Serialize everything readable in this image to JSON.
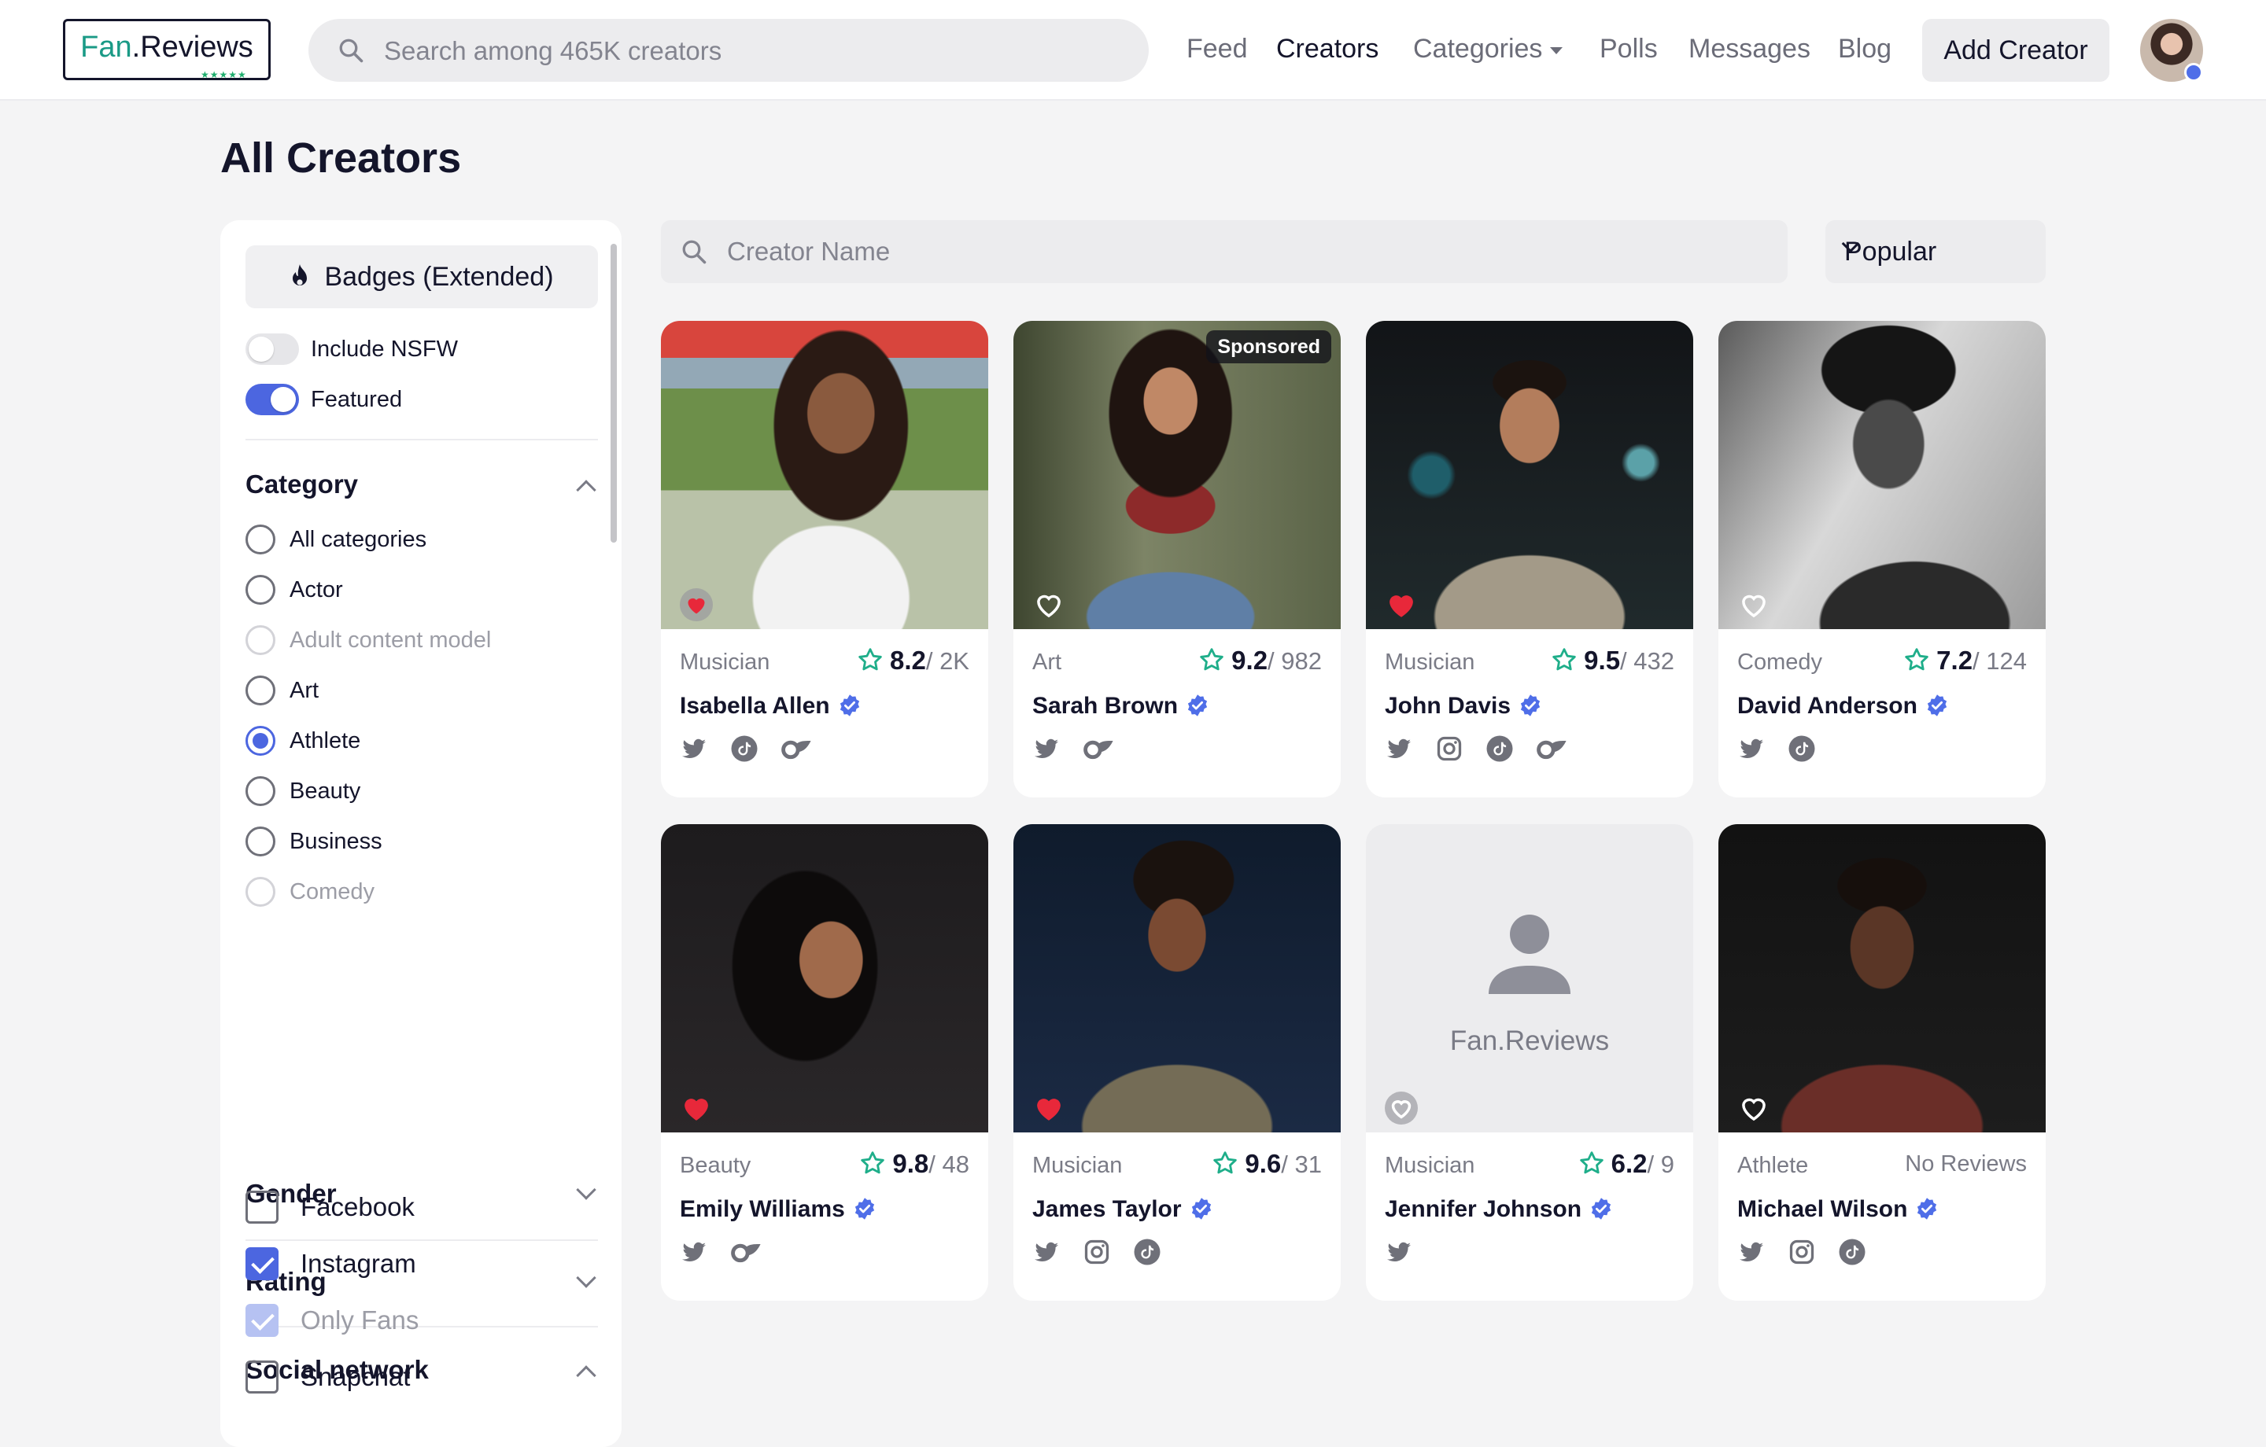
{
  "header": {
    "logo_fan": "Fan",
    "logo_rest": ".Reviews",
    "logo_stars": "★★★★★",
    "search_placeholder": "Search among 465K creators",
    "nav": [
      {
        "label": "Feed",
        "active": false
      },
      {
        "label": "Creators",
        "active": true
      },
      {
        "label": "Categories",
        "active": false
      },
      {
        "label": "Polls",
        "active": false
      },
      {
        "label": "Messages",
        "active": false
      },
      {
        "label": "Blog",
        "active": false
      }
    ],
    "add_creator": "Add Creator"
  },
  "page": {
    "title": "All Creators"
  },
  "filters": {
    "badges_button": "Badges (Extended)",
    "include_nsfw": {
      "label": "Include NSFW",
      "on": false
    },
    "featured": {
      "label": "Featured",
      "on": true
    },
    "category": {
      "title": "Category",
      "options": [
        {
          "label": "All categories",
          "state": "normal"
        },
        {
          "label": "Actor",
          "state": "normal"
        },
        {
          "label": "Adult content model",
          "state": "disabled"
        },
        {
          "label": "Art",
          "state": "normal"
        },
        {
          "label": "Athlete",
          "state": "selected"
        },
        {
          "label": "Beauty",
          "state": "normal"
        },
        {
          "label": "Business",
          "state": "normal"
        },
        {
          "label": "Comedy",
          "state": "disabled"
        }
      ]
    },
    "gender": {
      "title": "Gender"
    },
    "rating": {
      "title": "Rating"
    },
    "social": {
      "title": "Social network",
      "options": [
        {
          "label": "Facebook",
          "state": "off"
        },
        {
          "label": "Instagram",
          "state": "on"
        },
        {
          "label": "Only Fans",
          "state": "dim"
        },
        {
          "label": "Snapchat",
          "state": "off"
        }
      ]
    }
  },
  "main": {
    "search_placeholder": "Creator Name",
    "sort_value": "Popular"
  },
  "creators": [
    {
      "name": "Isabella Allen",
      "category": "Musician",
      "score": "8.2",
      "count": "/ 2K",
      "favorited": true,
      "sponsored": false,
      "socials": [
        "twitter-icon",
        "tiktok-icon",
        "onlyfans-icon"
      ]
    },
    {
      "name": "Sarah Brown",
      "category": "Art",
      "score": "9.2",
      "count": "/ 982",
      "favorited": false,
      "sponsored": true,
      "socials": [
        "twitter-icon",
        "onlyfans-icon"
      ]
    },
    {
      "name": "John Davis",
      "category": "Musician",
      "score": "9.5",
      "count": "/ 432",
      "favorited": true,
      "sponsored": false,
      "socials": [
        "twitter-icon",
        "instagram-icon",
        "tiktok-icon",
        "onlyfans-icon"
      ]
    },
    {
      "name": "David Anderson",
      "category": "Comedy",
      "score": "7.2",
      "count": "/ 124",
      "favorited": false,
      "sponsored": false,
      "socials": [
        "twitter-icon",
        "tiktok-icon"
      ]
    },
    {
      "name": "Emily Williams",
      "category": "Beauty",
      "score": "9.8",
      "count": "/ 48",
      "favorited": true,
      "sponsored": false,
      "socials": [
        "twitter-icon",
        "onlyfans-icon"
      ]
    },
    {
      "name": "James Taylor",
      "category": "Musician",
      "score": "9.6",
      "count": "/ 31",
      "favorited": true,
      "sponsored": false,
      "socials": [
        "twitter-icon",
        "instagram-icon",
        "tiktok-icon"
      ]
    },
    {
      "name": "Jennifer Johnson",
      "category": "Musician",
      "score": "6.2",
      "count": "/ 9",
      "favorited": false,
      "sponsored": false,
      "placeholder_text": "Fan.Reviews",
      "socials": [
        "twitter-icon"
      ]
    },
    {
      "name": "Michael Wilson",
      "category": "Athlete",
      "no_reviews": "No Reviews",
      "favorited": false,
      "sponsored": false,
      "socials": [
        "twitter-icon",
        "instagram-icon",
        "tiktok-icon"
      ]
    }
  ],
  "sponsored_label": "Sponsored",
  "colors": {
    "accent": "#4c66e0",
    "rating_star": "#1fae8a",
    "heart": "#e8283a",
    "brand_green": "#1a9a86"
  }
}
